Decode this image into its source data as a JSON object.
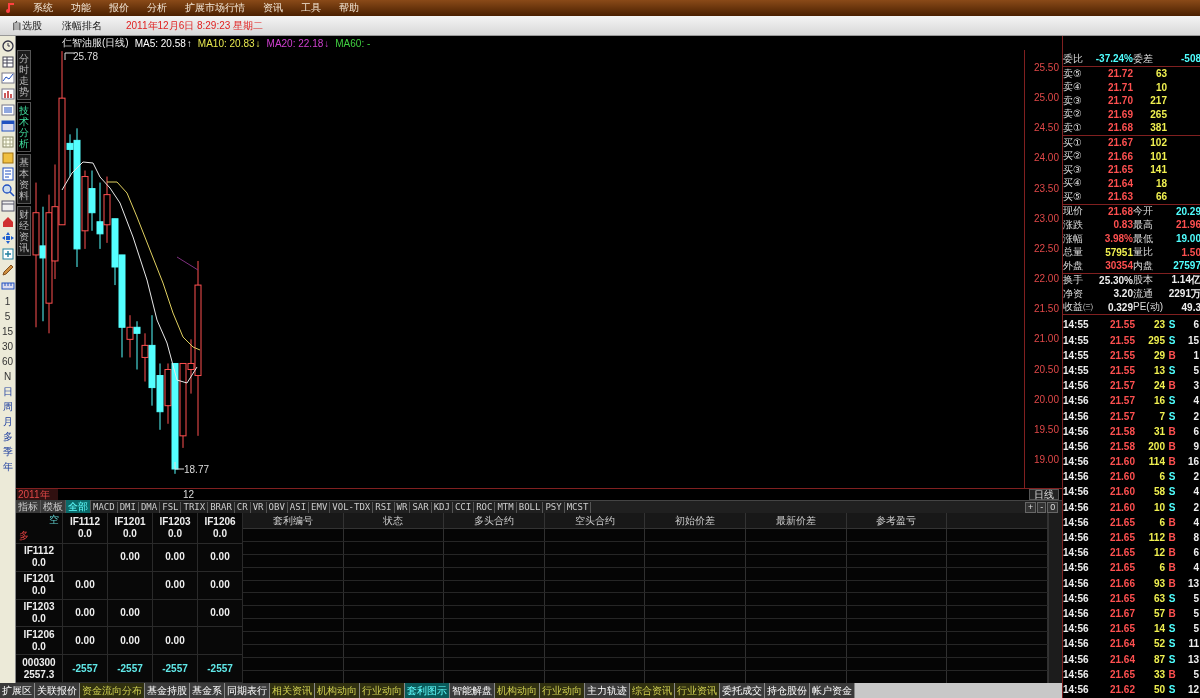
{
  "menu": [
    "系统",
    "功能",
    "报价",
    "分析",
    "扩展市场行情",
    "资讯",
    "工具",
    "帮助"
  ],
  "toolbar": {
    "buttons": [
      "自选股",
      "涨幅排名"
    ],
    "datetime": "2011年12月6日  8:29:23 星期二"
  },
  "periods": [
    "1",
    "5",
    "15",
    "30",
    "60",
    "N",
    "日",
    "周",
    "月",
    "多",
    "季",
    "年"
  ],
  "chart_tabs": [
    {
      "label": "分时走势",
      "selected": false
    },
    {
      "label": "技术分析",
      "selected": true
    },
    {
      "label": "基本资料",
      "selected": false
    },
    {
      "label": "财经资讯",
      "selected": false
    }
  ],
  "chart": {
    "title": "仁智油服(日线)",
    "indicators": [
      {
        "label": "MA5: 20.58",
        "arrow": "↑",
        "color": "#ffffff"
      },
      {
        "label": "MA10: 20.83",
        "arrow": "↓",
        "color": "#e8e850"
      },
      {
        "label": "MA20: 22.18",
        "arrow": "↓",
        "color": "#d040d0"
      },
      {
        "label": "MA60: -",
        "color": "#40d040"
      }
    ],
    "high_label": "25.78",
    "low_label": "18.77",
    "y_axis_labels": [
      "25.50",
      "25.00",
      "24.50",
      "24.00",
      "23.50",
      "23.00",
      "22.50",
      "22.00",
      "21.50",
      "21.00",
      "20.50",
      "20.00",
      "19.50",
      "19.00"
    ],
    "x_axis_labels": [
      "2011年",
      "12"
    ],
    "period_button": "日线",
    "axis_controls": [
      "+",
      "-",
      "0"
    ]
  },
  "indicator_tabs": [
    {
      "label": "指标",
      "selected": false
    },
    {
      "label": "模板",
      "selected": false
    },
    {
      "label": "全部",
      "selected": true
    },
    {
      "label": "MACD",
      "selected": false
    },
    {
      "label": "DMI",
      "selected": false
    },
    {
      "label": "DMA",
      "selected": false
    },
    {
      "label": "FSL",
      "selected": false
    },
    {
      "label": "TRIX",
      "selected": false
    },
    {
      "label": "BRAR",
      "selected": false
    },
    {
      "label": "CR",
      "selected": false
    },
    {
      "label": "VR",
      "selected": false
    },
    {
      "label": "OBV",
      "selected": false
    },
    {
      "label": "ASI",
      "selected": false
    },
    {
      "label": "EMV",
      "selected": false
    },
    {
      "label": "VOL-TDX",
      "selected": false
    },
    {
      "label": "RSI",
      "selected": false
    },
    {
      "label": "WR",
      "selected": false
    },
    {
      "label": "SAR",
      "selected": false
    },
    {
      "label": "KDJ",
      "selected": false
    },
    {
      "label": "CCI",
      "selected": false
    },
    {
      "label": "ROC",
      "selected": false
    },
    {
      "label": "MTM",
      "selected": false
    },
    {
      "label": "BOLL",
      "selected": false
    },
    {
      "label": "PSY",
      "selected": false
    },
    {
      "label": "MCST",
      "selected": false
    }
  ],
  "matrix": {
    "corner_top": "空",
    "corner_bottom": "多",
    "columns": [
      {
        "name": "IF1112",
        "value": "0.0"
      },
      {
        "name": "IF1201",
        "value": "0.0"
      },
      {
        "name": "IF1203",
        "value": "0.0"
      },
      {
        "name": "IF1206",
        "value": "0.0"
      }
    ],
    "rows": [
      {
        "name": "IF1112",
        "value": "0.0",
        "kind": "pair",
        "cells": [
          null,
          "0.00",
          "0.00",
          "0.00"
        ]
      },
      {
        "name": "IF1201",
        "value": "0.0",
        "kind": "pair",
        "cells": [
          "0.00",
          null,
          "0.00",
          "0.00"
        ]
      },
      {
        "name": "IF1203",
        "value": "0.0",
        "kind": "pair",
        "cells": [
          "0.00",
          "0.00",
          null,
          "0.00"
        ]
      },
      {
        "name": "IF1206",
        "value": "0.0",
        "kind": "pair",
        "cells": [
          "0.00",
          "0.00",
          "0.00",
          null
        ]
      },
      {
        "name": "000300",
        "value": "2557.3",
        "kind": "index",
        "cells": [
          "-2557",
          "-2557",
          "-2557",
          "-2557"
        ]
      }
    ]
  },
  "arbitrage_table": {
    "columns": [
      "套利编号",
      "状态",
      "多头合约",
      "空头合约",
      "初始价差",
      "最新价差",
      "参考盈亏"
    ]
  },
  "bottom_tabs": [
    {
      "label": "扩展区",
      "kind": "plain",
      "selected": false
    },
    {
      "label": "关联报价",
      "kind": "plain",
      "selected": false
    },
    {
      "label": "资金流向分布",
      "kind": "news",
      "selected": false
    },
    {
      "label": "基金持股",
      "kind": "plain",
      "selected": false
    },
    {
      "label": "基金系",
      "kind": "plain",
      "selected": false
    },
    {
      "label": "同期表行",
      "kind": "plain",
      "selected": false
    },
    {
      "label": "相关资讯",
      "kind": "news",
      "selected": false
    },
    {
      "label": "机构动向",
      "kind": "news",
      "selected": false
    },
    {
      "label": "行业动向",
      "kind": "news",
      "selected": false
    },
    {
      "label": "套利图示",
      "kind": "plain",
      "selected": true
    },
    {
      "label": "智能解盘",
      "kind": "plain",
      "selected": false
    },
    {
      "label": "机构动向",
      "kind": "news",
      "selected": false
    },
    {
      "label": "行业动向",
      "kind": "news",
      "selected": false
    },
    {
      "label": "主力轨迹",
      "kind": "plain",
      "selected": false
    },
    {
      "label": "综合资讯",
      "kind": "news",
      "selected": false
    },
    {
      "label": "行业资讯",
      "kind": "news",
      "selected": false
    },
    {
      "label": "委托成交",
      "kind": "plain",
      "selected": false
    },
    {
      "label": "持仓股份",
      "kind": "plain",
      "selected": false
    },
    {
      "label": "帐户资金",
      "kind": "plain",
      "selected": false
    }
  ],
  "quote_panel": {
    "ratio": [
      {
        "label": "委比",
        "value": "-37.24%",
        "color": "#50ffff"
      },
      {
        "label": "委差",
        "value": "-508",
        "color": "#50ffff"
      }
    ],
    "asks": [
      {
        "label": "卖⑤",
        "price": "21.72",
        "volume": "63"
      },
      {
        "label": "卖④",
        "price": "21.71",
        "volume": "10"
      },
      {
        "label": "卖③",
        "price": "21.70",
        "volume": "217"
      },
      {
        "label": "卖②",
        "price": "21.69",
        "volume": "265"
      },
      {
        "label": "卖①",
        "price": "21.68",
        "volume": "381"
      }
    ],
    "bids": [
      {
        "label": "买①",
        "price": "21.67",
        "volume": "102"
      },
      {
        "label": "买②",
        "price": "21.66",
        "volume": "101"
      },
      {
        "label": "买③",
        "price": "21.65",
        "volume": "141"
      },
      {
        "label": "买④",
        "price": "21.64",
        "volume": "18"
      },
      {
        "label": "买⑤",
        "price": "21.63",
        "volume": "66"
      }
    ],
    "quote": [
      {
        "label": "现价",
        "value": "21.68",
        "color": "#ff5050"
      },
      {
        "label": "今开",
        "value": "20.29",
        "color": "#50ffff"
      },
      {
        "label": "涨跌",
        "value": "0.83",
        "color": "#ff5050"
      },
      {
        "label": "最高",
        "value": "21.96",
        "color": "#ff5050"
      },
      {
        "label": "涨幅",
        "value": "3.98%",
        "color": "#ff5050"
      },
      {
        "label": "最低",
        "value": "19.00",
        "color": "#50ffff"
      },
      {
        "label": "总量",
        "value": "57951",
        "color": "#f0f050"
      },
      {
        "label": "量比",
        "value": "1.50",
        "color": "#ff5050"
      },
      {
        "label": "外盘",
        "value": "30354",
        "color": "#ff5050"
      },
      {
        "label": "内盘",
        "value": "27597",
        "color": "#50ffff"
      }
    ],
    "fundamentals": [
      {
        "label": "换手",
        "value": "25.30%"
      },
      {
        "label": "股本",
        "value": "1.14亿"
      },
      {
        "label": "净资",
        "value": "3.20"
      },
      {
        "label": "流通",
        "value": "2291万"
      },
      {
        "label": "收益㈢",
        "value": "0.329"
      },
      {
        "label": "PE(动)",
        "value": "49.3"
      }
    ],
    "ticks": [
      {
        "time": "14:55",
        "price": "21.55",
        "volume": "23",
        "side": "S",
        "kind": "sell",
        "count": "6"
      },
      {
        "time": "14:55",
        "price": "21.55",
        "volume": "295",
        "side": "S",
        "kind": "sell",
        "count": "15"
      },
      {
        "time": "14:55",
        "price": "21.55",
        "volume": "29",
        "side": "B",
        "kind": "buy",
        "count": "1"
      },
      {
        "time": "14:55",
        "price": "21.55",
        "volume": "13",
        "side": "S",
        "kind": "sell",
        "count": "5"
      },
      {
        "time": "14:56",
        "price": "21.57",
        "volume": "24",
        "side": "B",
        "kind": "buy",
        "count": "3"
      },
      {
        "time": "14:56",
        "price": "21.57",
        "volume": "16",
        "side": "S",
        "kind": "sell",
        "count": "4"
      },
      {
        "time": "14:56",
        "price": "21.57",
        "volume": "7",
        "side": "S",
        "kind": "sell",
        "count": "2"
      },
      {
        "time": "14:56",
        "price": "21.58",
        "volume": "31",
        "side": "B",
        "kind": "buy",
        "count": "6"
      },
      {
        "time": "14:56",
        "price": "21.58",
        "volume": "200",
        "side": "B",
        "kind": "buy",
        "count": "9"
      },
      {
        "time": "14:56",
        "price": "21.60",
        "volume": "114",
        "side": "B",
        "kind": "buy",
        "count": "16"
      },
      {
        "time": "14:56",
        "price": "21.60",
        "volume": "6",
        "side": "S",
        "kind": "sell",
        "count": "2"
      },
      {
        "time": "14:56",
        "price": "21.60",
        "volume": "58",
        "side": "S",
        "kind": "sell",
        "count": "4"
      },
      {
        "time": "14:56",
        "price": "21.60",
        "volume": "10",
        "side": "S",
        "kind": "sell",
        "count": "2"
      },
      {
        "time": "14:56",
        "price": "21.65",
        "volume": "6",
        "side": "B",
        "kind": "buy",
        "count": "4"
      },
      {
        "time": "14:56",
        "price": "21.65",
        "volume": "112",
        "side": "B",
        "kind": "buy",
        "count": "8"
      },
      {
        "time": "14:56",
        "price": "21.65",
        "volume": "12",
        "side": "B",
        "kind": "buy",
        "count": "6"
      },
      {
        "time": "14:56",
        "price": "21.65",
        "volume": "6",
        "side": "B",
        "kind": "buy",
        "count": "4"
      },
      {
        "time": "14:56",
        "price": "21.66",
        "volume": "93",
        "side": "B",
        "kind": "buy",
        "count": "13"
      },
      {
        "time": "14:56",
        "price": "21.65",
        "volume": "63",
        "side": "S",
        "kind": "sell",
        "count": "5"
      },
      {
        "time": "14:56",
        "price": "21.67",
        "volume": "57",
        "side": "B",
        "kind": "buy",
        "count": "5"
      },
      {
        "time": "14:56",
        "price": "21.65",
        "volume": "14",
        "side": "S",
        "kind": "sell",
        "count": "5"
      },
      {
        "time": "14:56",
        "price": "21.64",
        "volume": "52",
        "side": "S",
        "kind": "sell",
        "count": "11"
      },
      {
        "time": "14:56",
        "price": "21.64",
        "volume": "87",
        "side": "S",
        "kind": "sell",
        "count": "13"
      },
      {
        "time": "14:56",
        "price": "21.65",
        "volume": "33",
        "side": "B",
        "kind": "buy",
        "count": "5"
      },
      {
        "time": "14:56",
        "price": "21.62",
        "volume": "50",
        "side": "S",
        "kind": "sell",
        "count": "12"
      }
    ]
  }
}
